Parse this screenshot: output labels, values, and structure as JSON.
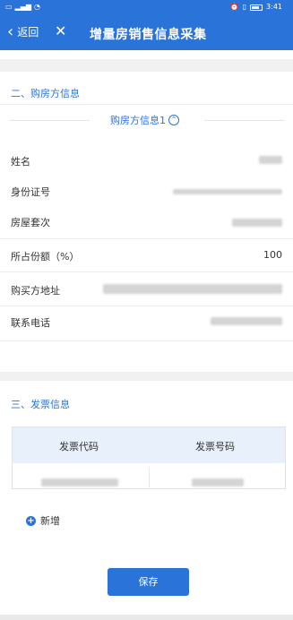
{
  "status_bar": {
    "time": "3:41",
    "left_icons": [
      "message-icon",
      "signal-icon",
      "wifi-icon"
    ],
    "right_icons": [
      "alarm-icon",
      "vibrate-icon",
      "battery-icon"
    ]
  },
  "header": {
    "back_label": "返回",
    "title": "增量房销售信息采集"
  },
  "buyer_section": {
    "title": "二、购房方信息",
    "subtitle": "购房方信息1",
    "fields": [
      {
        "label": "姓名",
        "value": ""
      },
      {
        "label": "身份证号",
        "value": ""
      },
      {
        "label": "房屋套次",
        "value": ""
      },
      {
        "label": "所占份额（%）",
        "value": "100"
      },
      {
        "label": "购买方地址",
        "value": ""
      },
      {
        "label": "联系电话",
        "value": ""
      }
    ]
  },
  "invoice_section": {
    "title": "三、发票信息",
    "columns": [
      "发票代码",
      "发票号码"
    ]
  },
  "actions": {
    "add_label": "新增",
    "save_label": "保存"
  },
  "colors": {
    "primary": "#2a73d8",
    "table_header_bg": "#e8f0fb",
    "band_gray": "#f1f1f1"
  }
}
